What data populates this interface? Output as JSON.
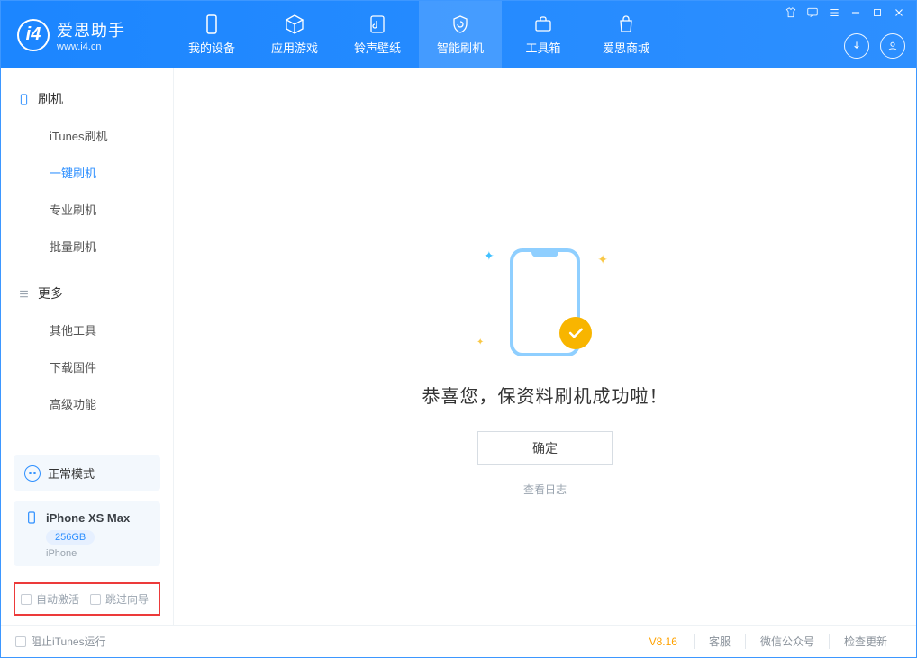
{
  "app": {
    "title_cn": "爱思助手",
    "title_en": "www.i4.cn"
  },
  "nav": {
    "device": "我的设备",
    "apps": "应用游戏",
    "ringtones": "铃声壁纸",
    "flash": "智能刷机",
    "toolbox": "工具箱",
    "store": "爱思商城"
  },
  "sidebar": {
    "group_flash": "刷机",
    "group_more": "更多",
    "items": {
      "itunes_flash": "iTunes刷机",
      "one_key_flash": "一键刷机",
      "pro_flash": "专业刷机",
      "batch_flash": "批量刷机",
      "other_tools": "其他工具",
      "download_firmware": "下载固件",
      "advanced": "高级功能"
    },
    "mode": "正常模式",
    "device": {
      "name": "iPhone XS Max",
      "capacity": "256GB",
      "type": "iPhone"
    },
    "opts": {
      "auto_activate": "自动激活",
      "skip_guide": "跳过向导"
    }
  },
  "main": {
    "success_msg": "恭喜您，保资料刷机成功啦！",
    "ok_label": "确定",
    "view_log": "查看日志"
  },
  "footer": {
    "block_itunes": "阻止iTunes运行",
    "version": "V8.16",
    "support": "客服",
    "wechat": "微信公众号",
    "check_update": "检查更新"
  }
}
